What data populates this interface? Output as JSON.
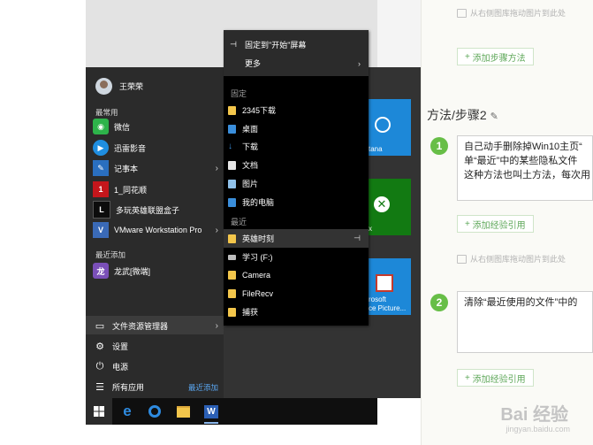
{
  "start_menu": {
    "user_name": "王荣荣",
    "most_used_header": "最常用",
    "apps": [
      {
        "label": "微信",
        "icon": "wechat-icon",
        "color": "#2db34a"
      },
      {
        "label": "迅雷影音",
        "icon": "thunder-player-icon",
        "color": "#1f8ee0"
      },
      {
        "label": "记事本",
        "icon": "notepad-icon",
        "color": "#2a6fbf"
      },
      {
        "label": "1_同花顺",
        "icon": "tonghuashun-icon",
        "color": "#c4161c"
      },
      {
        "label": "多玩英雄联盟盒子",
        "icon": "lol-box-icon",
        "color": "#0c0c0c"
      },
      {
        "label": "VMware Workstation Pro",
        "icon": "vmware-icon",
        "color": "#3a6ab7"
      }
    ],
    "recent_header": "最近添加",
    "recent_apps": [
      {
        "label": "龙武[微端]",
        "icon": "longwu-icon",
        "color": "#7a4fb8"
      }
    ],
    "file_explorer_label": "文件资源管理器",
    "settings_label": "设置",
    "power_label": "电源",
    "all_apps_label": "所有应用",
    "recently_added_link": "最近添加"
  },
  "jump_list": {
    "pin_to_start": "固定到\"开始\"屏幕",
    "more": "更多",
    "pinned_header": "固定",
    "pinned": [
      {
        "label": "2345下载",
        "icon": "folder-icon"
      },
      {
        "label": "桌面",
        "icon": "desktop-icon"
      },
      {
        "label": "下载",
        "icon": "download-icon"
      },
      {
        "label": "文档",
        "icon": "document-icon"
      },
      {
        "label": "图片",
        "icon": "pictures-icon"
      },
      {
        "label": "我的电脑",
        "icon": "computer-icon"
      }
    ],
    "recent_header": "最近",
    "recent": [
      {
        "label": "英雄时刻",
        "icon": "folder-icon"
      },
      {
        "label": "学习 (F:)",
        "icon": "drive-icon"
      },
      {
        "label": "Camera",
        "icon": "folder-icon"
      },
      {
        "label": "FileRecv",
        "icon": "folder-icon"
      },
      {
        "label": "捕获",
        "icon": "folder-icon"
      }
    ]
  },
  "tiles": {
    "cortana_label": "tana",
    "xbox_label": "x",
    "picture_manager_label_1": "rosoft",
    "picture_manager_label_2": "ce Picture..."
  },
  "editor": {
    "drag_hint": "从右侧图库拖动图片到此处",
    "add_step_method": "添加步骤方法",
    "step_title": "方法/步骤2",
    "step1_number": "1",
    "step1_lines": [
      "自己动手删除掉Win10主页“",
      "单“最近”中的某些隐私文件",
      "这种方法也叫土方法，每次用"
    ],
    "add_experience_ref": "添加经验引用",
    "step2_number": "2",
    "step2_text": "清除“最近使用的文件”中的"
  },
  "watermark": {
    "brand": "Bai 经验",
    "url": "jingyan.baidu.com"
  },
  "colors": {
    "start_bg": "#2b2b2b",
    "tile_blue": "#1d88d8",
    "tile_green": "#127a12",
    "accent_green": "#67be47"
  }
}
